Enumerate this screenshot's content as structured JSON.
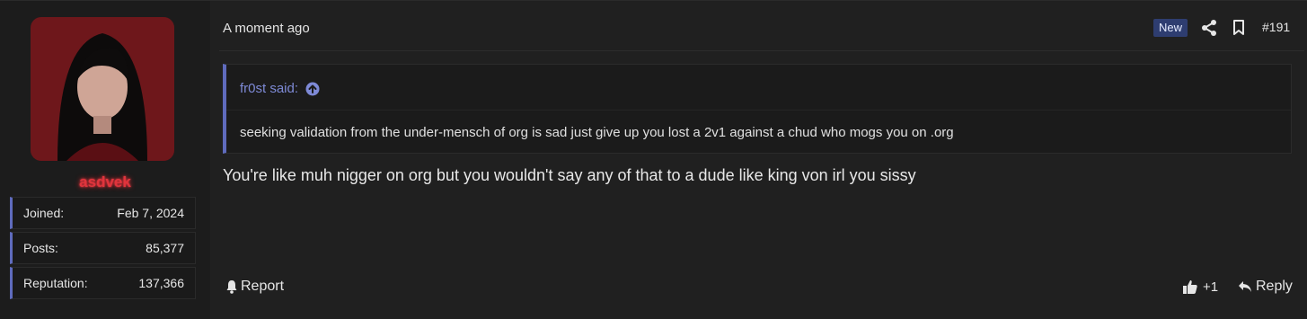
{
  "user": {
    "name": "asdvek",
    "name_color": "#e0343c",
    "stats": [
      {
        "label": "Joined:",
        "value": "Feb 7, 2024"
      },
      {
        "label": "Posts:",
        "value": "85,377"
      },
      {
        "label": "Reputation:",
        "value": "137,366"
      }
    ]
  },
  "post": {
    "timestamp": "A moment ago",
    "badge": "New",
    "number": "#191",
    "quote": {
      "author_line": "fr0st said:",
      "text": "seeking validation from the under-mensch of org is sad just give up you lost a 2v1 against a chud who mogs you on .org"
    },
    "message": "You're like muh nigger on org but you wouldn't say any of that to a dude like king von irl you sissy"
  },
  "footer": {
    "report_label": "Report",
    "reaction_count": "+1",
    "reply_label": "Reply"
  },
  "colors": {
    "accent": "#5f6bbd",
    "badge_bg": "#2e3d70",
    "quote_link": "#7e8ad6"
  },
  "icons": {
    "share": "share-icon",
    "bookmark": "bookmark-icon",
    "quote_jump": "arrow-up-circle-icon",
    "report": "bell-icon",
    "like": "thumbs-up-icon",
    "reply": "reply-arrow-icon"
  }
}
